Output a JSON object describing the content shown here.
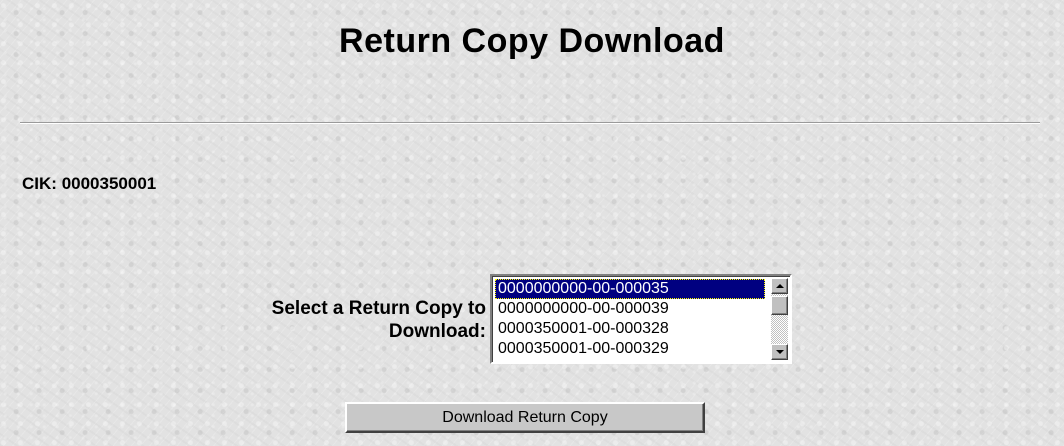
{
  "page": {
    "title": "Return Copy Download"
  },
  "cik": {
    "label": "CIK:",
    "value": "0000350001"
  },
  "return_copy_select": {
    "label_line1": "Select a Return Copy to",
    "label_line2": "Download:",
    "options": [
      "0000000000-00-000035",
      "0000000000-00-000039",
      "0000350001-00-000328",
      "0000350001-00-000329"
    ],
    "selected_index": 0
  },
  "actions": {
    "download_label": "Download Return Copy"
  },
  "colors": {
    "selection_background": "#000080",
    "selection_text": "#ffffff",
    "page_background": "#e2e2e2"
  }
}
